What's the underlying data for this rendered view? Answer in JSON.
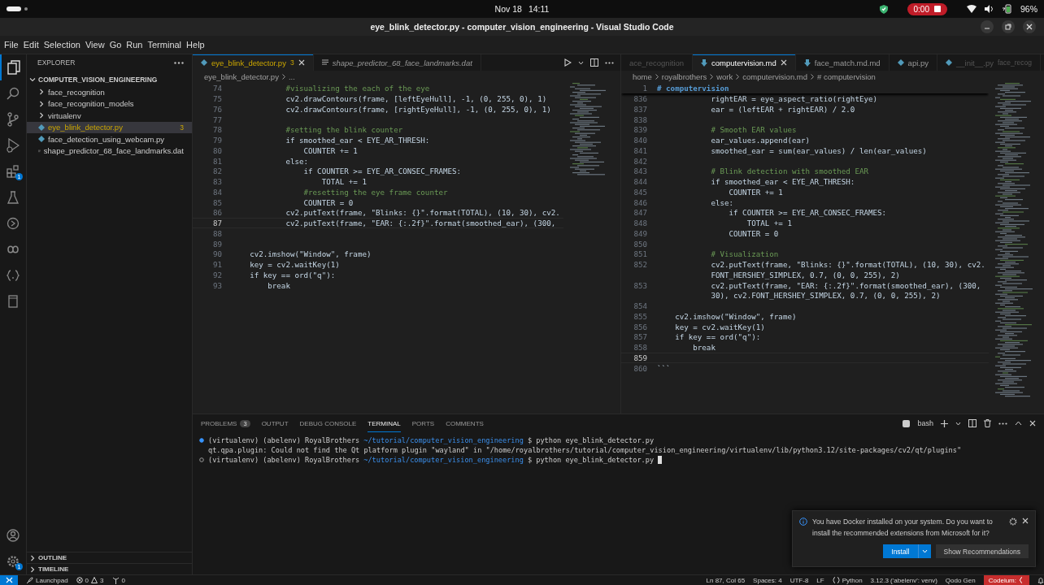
{
  "top_bar": {
    "date": "Nov 18",
    "time": "14:11",
    "recording": "0:00",
    "battery": "96%"
  },
  "window": {
    "title": "eye_blink_detector.py - computer_vision_engineering - Visual Studio Code"
  },
  "menu": [
    "File",
    "Edit",
    "Selection",
    "View",
    "Go",
    "Run",
    "Terminal",
    "Help"
  ],
  "activity_bar": {
    "extensions_badge": "1",
    "settings_badge": "1"
  },
  "sidebar": {
    "title": "EXPLORER",
    "root": {
      "label": "COMPUTER_VISION_ENGINEERING",
      "expanded": true,
      "children": [
        {
          "label": "face_recognition",
          "kind": "folder",
          "expanded": false,
          "selected": false
        },
        {
          "label": "face_recognition_models",
          "kind": "folder",
          "expanded": false,
          "selected": false
        },
        {
          "label": "virtualenv",
          "kind": "folder",
          "expanded": false,
          "selected": false
        },
        {
          "label": "eye_blink_detector.py",
          "kind": "python",
          "selected": true,
          "badge": "3"
        },
        {
          "label": "face_detection_using_webcam.py",
          "kind": "python",
          "selected": false
        },
        {
          "label": "shape_predictor_68_face_landmarks.dat",
          "kind": "text",
          "selected": false
        }
      ]
    },
    "sections": [
      {
        "label": "OUTLINE",
        "expanded": false
      },
      {
        "label": "TIMELINE",
        "expanded": false
      }
    ]
  },
  "editors": [
    {
      "tabs": [
        {
          "label": "eye_blink_detector.py",
          "kind": "python",
          "badge": "3",
          "selected": true,
          "preview": false,
          "faded": false
        },
        {
          "label": "shape_predictor_68_face_landmarks.dat",
          "kind": "text",
          "selected": false,
          "preview": true,
          "faded": false
        }
      ],
      "breadcrumbs": [
        "eye_blink_detector.py",
        "..."
      ],
      "lines": [
        {
          "n": "74",
          "current": false,
          "kind": "comment",
          "text": "            #visualizing the each of the eye"
        },
        {
          "n": "75",
          "current": false,
          "kind": "code",
          "text": "            cv2.drawContours(frame, [leftEyeHull], -1, (0, 255, 0), 1)"
        },
        {
          "n": "76",
          "current": false,
          "kind": "code",
          "text": "            cv2.drawContours(frame, [rightEyeHull], -1, (0, 255, 0), 1)"
        },
        {
          "n": "77",
          "current": false
        },
        {
          "n": "78",
          "current": false,
          "kind": "comment",
          "text": "            #setting the blink counter"
        },
        {
          "n": "79",
          "current": false,
          "kind": "code",
          "text": "            if smoothed_ear < EYE_AR_THRESH:"
        },
        {
          "n": "80",
          "current": false,
          "kind": "code",
          "text": "                COUNTER += 1"
        },
        {
          "n": "81",
          "current": false,
          "kind": "code",
          "text": "            else:"
        },
        {
          "n": "82",
          "current": false,
          "kind": "code",
          "text": "                if COUNTER >= EYE_AR_CONSEC_FRAMES:"
        },
        {
          "n": "83",
          "current": false,
          "kind": "code",
          "text": "                    TOTAL += 1"
        },
        {
          "n": "84",
          "current": false,
          "kind": "comment",
          "text": "                #resetting the eye frame counter"
        },
        {
          "n": "85",
          "current": false,
          "kind": "code",
          "text": "                COUNTER = 0"
        },
        {
          "n": "86",
          "current": false,
          "kind": "code",
          "text": "            cv2.putText(frame, \"Blinks: {}\".format(TOTAL), (10, 30), cv2."
        },
        {
          "n": "87",
          "current": true,
          "kind": "code",
          "text": "            cv2.putText(frame, \"EAR: {:.2f}\".format(smoothed_ear), (300,"
        },
        {
          "n": "88",
          "current": false
        },
        {
          "n": "89",
          "current": false
        },
        {
          "n": "90",
          "current": false,
          "kind": "code",
          "text": "    cv2.imshow(\"Window\", frame)"
        },
        {
          "n": "91",
          "current": false,
          "kind": "code",
          "text": "    key = cv2.waitKey(1)"
        },
        {
          "n": "92",
          "current": false,
          "kind": "code",
          "text": "    if key == ord(\"q\"):"
        },
        {
          "n": "93",
          "current": false,
          "kind": "code",
          "text": "        break"
        }
      ]
    },
    {
      "tabs": [
        {
          "label": "ace_recognition",
          "kind": "none",
          "selected": false,
          "preview": false,
          "faded": true
        },
        {
          "label": "computervision.md",
          "kind": "markdown",
          "selected": true,
          "preview": false,
          "faded": false
        },
        {
          "label": "face_match.md.md",
          "kind": "markdown",
          "selected": false,
          "preview": false,
          "faded": false
        },
        {
          "label": "api.py",
          "kind": "python",
          "selected": false,
          "preview": false,
          "faded": false
        },
        {
          "label": "__init__.py",
          "description": "face_recog",
          "kind": "python",
          "selected": false,
          "preview": false,
          "faded": true
        }
      ],
      "breadcrumbs": [
        "home",
        "royalbrothers",
        "work",
        "computervision.md",
        "# computervision"
      ],
      "sticky": {
        "n": "1",
        "text": "# computervision"
      },
      "lines": [
        {
          "n": "836",
          "current": false,
          "kind": "code",
          "text": "            rightEAR = eye_aspect_ratio(rightEye)"
        },
        {
          "n": "837",
          "current": false,
          "kind": "code",
          "text": "            ear = (leftEAR + rightEAR) / 2.0"
        },
        {
          "n": "838",
          "current": false
        },
        {
          "n": "839",
          "current": false,
          "kind": "comment",
          "text": "            # Smooth EAR values"
        },
        {
          "n": "840",
          "current": false,
          "kind": "code",
          "text": "            ear_values.append(ear)"
        },
        {
          "n": "841",
          "current": false,
          "kind": "code",
          "text": "            smoothed_ear = sum(ear_values) / len(ear_values)"
        },
        {
          "n": "842",
          "current": false
        },
        {
          "n": "843",
          "current": false,
          "kind": "comment",
          "text": "            # Blink detection with smoothed EAR"
        },
        {
          "n": "844",
          "current": false,
          "kind": "code",
          "text": "            if smoothed_ear < EYE_AR_THRESH:"
        },
        {
          "n": "845",
          "current": false,
          "kind": "code",
          "text": "                COUNTER += 1"
        },
        {
          "n": "846",
          "current": false,
          "kind": "code",
          "text": "            else:"
        },
        {
          "n": "847",
          "current": false,
          "kind": "code",
          "text": "                if COUNTER >= EYE_AR_CONSEC_FRAMES:"
        },
        {
          "n": "848",
          "current": false,
          "kind": "code",
          "text": "                    TOTAL += 1"
        },
        {
          "n": "849",
          "current": false,
          "kind": "code",
          "text": "                COUNTER = 0"
        },
        {
          "n": "850",
          "current": false
        },
        {
          "n": "851",
          "current": false,
          "kind": "comment",
          "text": "            # Visualization"
        },
        {
          "n": "852",
          "current": false,
          "kind": "code",
          "text": "            cv2.putText(frame, \"Blinks: {}\".format(TOTAL), (10, 30), cv2."
        },
        {
          "kind": "code",
          "text": "            FONT_HERSHEY_SIMPLEX, 0.7, (0, 0, 255), 2)"
        },
        {
          "n": "853",
          "current": false,
          "kind": "code",
          "text": "            cv2.putText(frame, \"EAR: {:.2f}\".format(smoothed_ear), (300,"
        },
        {
          "kind": "code",
          "text": "            30), cv2.FONT_HERSHEY_SIMPLEX, 0.7, (0, 0, 255), 2)"
        },
        {
          "n": "854",
          "current": false
        },
        {
          "n": "855",
          "current": false,
          "kind": "code",
          "text": "    cv2.imshow(\"Window\", frame)"
        },
        {
          "n": "856",
          "current": false,
          "kind": "code",
          "text": "    key = cv2.waitKey(1)"
        },
        {
          "n": "857",
          "current": false,
          "kind": "code",
          "text": "    if key == ord(\"q\"):"
        },
        {
          "n": "858",
          "current": false,
          "kind": "code",
          "text": "        break"
        },
        {
          "n": "859",
          "current": true
        },
        {
          "n": "860",
          "current": false,
          "kind": "code",
          "text": "```"
        }
      ]
    }
  ],
  "panel": {
    "tabs": [
      {
        "label": "PROBLEMS",
        "badge": "3",
        "selected": false
      },
      {
        "label": "OUTPUT",
        "selected": false
      },
      {
        "label": "DEBUG CONSOLE",
        "selected": false
      },
      {
        "label": "TERMINAL",
        "selected": true
      },
      {
        "label": "PORTS",
        "selected": false
      },
      {
        "label": "COMMENTS",
        "selected": false
      }
    ],
    "shell": "bash",
    "terminal": [
      {
        "kind": "prompt",
        "finished": true,
        "cursor": false,
        "prompt": "(virtualenv) (abelenv) RoyalBrothers",
        "path": "~/tutorial/computer_vision_engineering",
        "command": "$ python eye_blink_detector.py"
      },
      {
        "kind": "output",
        "text": "qt.qpa.plugin: Could not find the Qt platform plugin \"wayland\" in \"/home/royalbrothers/tutorial/computer_vision_engineering/virtualenv/lib/python3.12/site-packages/cv2/qt/plugins\""
      },
      {
        "kind": "prompt",
        "finished": false,
        "cursor": true,
        "prompt": "(virtualenv) (abelenv) RoyalBrothers",
        "path": "~/tutorial/computer_vision_engineering",
        "command": "$ python eye_blink_detector.py"
      }
    ]
  },
  "notification": {
    "text": "You have Docker installed on your system. Do you want to install the recommended extensions from Microsoft for it?",
    "buttons": [
      {
        "label": "Install",
        "kind": "primary"
      },
      {
        "label": "Show Recommendations",
        "kind": "secondary"
      }
    ]
  },
  "status_bar": {
    "launchpad": "Launchpad",
    "errors": "0",
    "warnings": "3",
    "ports": "0",
    "items": [
      "Ln 87, Col 65",
      "Spaces: 4",
      "UTF-8",
      "LF"
    ],
    "language": "Python",
    "interpreter": "3.12.3 ('abelenv': venv)",
    "qodo": "Qodo Gen",
    "codeium": "Codeium:"
  }
}
